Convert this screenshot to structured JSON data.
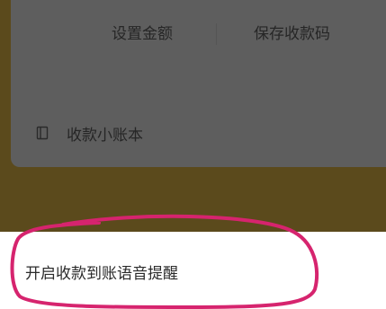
{
  "colors": {
    "backdrop": "#5b4a1c",
    "card_dimmed": "#5e5e5e",
    "sheet": "#ffffff",
    "annotation": "#d6246e"
  },
  "card": {
    "actions": [
      {
        "label": "设置金额"
      },
      {
        "label": "保存收款码"
      }
    ],
    "ledger": {
      "icon": "notebook-icon",
      "label": "收款小账本"
    }
  },
  "sheet": {
    "voice_alert_label": "开启收款到账语音提醒"
  }
}
